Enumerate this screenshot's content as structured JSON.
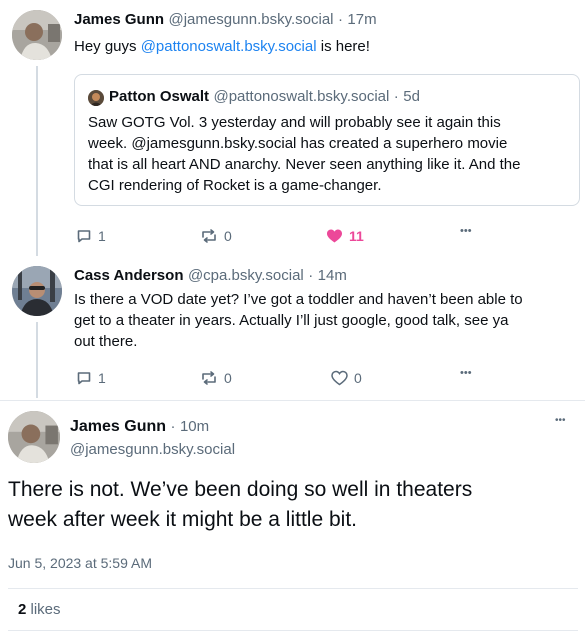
{
  "post1": {
    "author_name": "James Gunn",
    "author_handle": "@jamesgunn.bsky.social",
    "time": "17m",
    "text_before": "Hey guys ",
    "mention": "@pattonoswalt.bsky.social",
    "text_after": " is here!",
    "quote": {
      "author_name": "Patton Oswalt",
      "author_handle": "@pattonoswalt.bsky.social",
      "time": "5d",
      "lines": [
        "Saw GOTG Vol. 3 yesterday and will probably see it again this",
        "week. @jamesgunn.bsky.social has created a superhero movie",
        "that is all heart AND anarchy. Never seen anything like it. And the",
        "CGI rendering of Rocket is a game-changer."
      ]
    },
    "actions": {
      "reply_count": "1",
      "repost_count": "0",
      "like_count": "11"
    }
  },
  "post2": {
    "author_name": "Cass Anderson",
    "author_handle": "@cpa.bsky.social",
    "time": "14m",
    "lines": [
      "Is there a VOD date yet? I’ve got a toddler and haven’t been able to",
      "get to a theater in years. Actually I’ll just google, good talk, see ya",
      "out there."
    ],
    "actions": {
      "reply_count": "1",
      "repost_count": "0",
      "like_count": "0"
    }
  },
  "post3": {
    "author_name": "James Gunn",
    "time": "10m",
    "author_handle": "@jamesgunn.bsky.social",
    "lines": [
      "There is not. We’ve been doing so well in theaters",
      "week after week it might be a little bit."
    ],
    "timestamp": "Jun 5, 2023 at 5:59 AM",
    "likes_count": "2",
    "likes_label": "likes"
  },
  "colors": {
    "link": "#1d83f0",
    "liked": "#ec4899",
    "muted": "#5b6b7a",
    "border": "#d4dbe2"
  },
  "icons": [
    "reply-icon",
    "repost-icon",
    "heart-icon",
    "more-icon"
  ],
  "separators": {
    "dot": "·",
    "ellipsis": "•••"
  }
}
